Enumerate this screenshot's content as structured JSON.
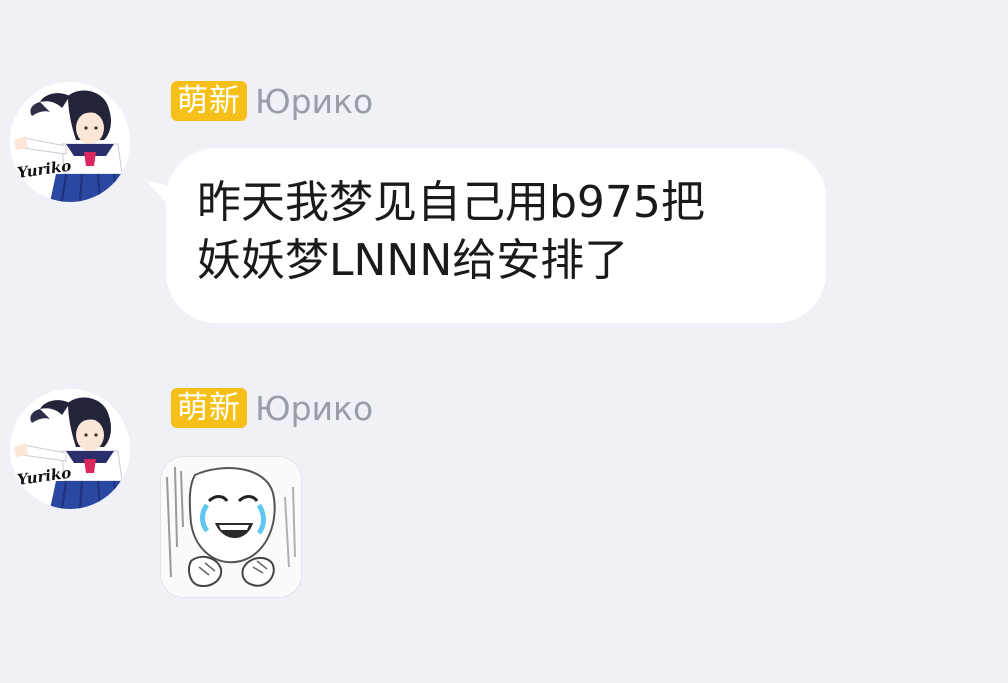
{
  "messages": [
    {
      "badge": "萌新",
      "sender": "Юрико",
      "avatar_signature": "Yuriko",
      "text_line1": "昨天我梦见自己用b975把",
      "text_line2": "妖妖梦LNNN给安排了"
    },
    {
      "badge": "萌新",
      "sender": "Юрико",
      "avatar_signature": "Yuriko",
      "sticker": "crying-laughing-meme-sticker"
    }
  ]
}
